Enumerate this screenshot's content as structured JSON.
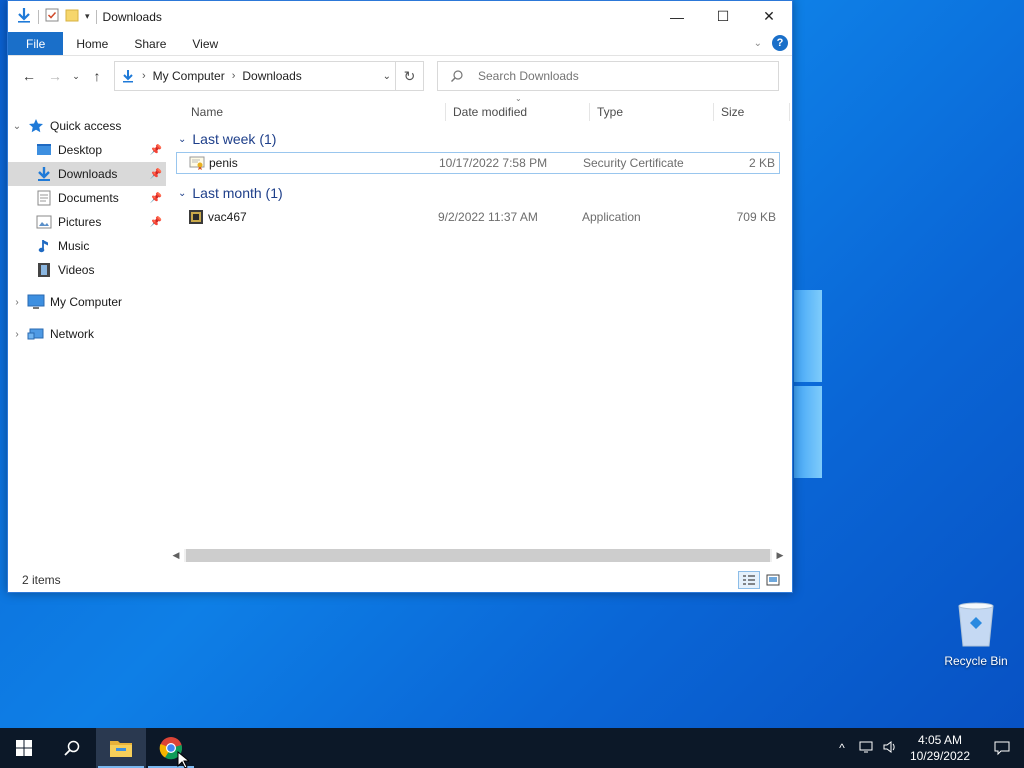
{
  "window": {
    "title": "Downloads",
    "controls": {
      "minimize": "—",
      "maximize": "☐",
      "close": "✕"
    }
  },
  "ribbon": {
    "tabs": [
      "File",
      "Home",
      "Share",
      "View"
    ],
    "help": "?"
  },
  "address": {
    "crumbs": [
      "My Computer",
      "Downloads"
    ],
    "search_placeholder": "Search Downloads"
  },
  "nav": {
    "quick_access": "Quick access",
    "items": [
      {
        "label": "Desktop",
        "pinned": true
      },
      {
        "label": "Downloads",
        "pinned": true,
        "selected": true
      },
      {
        "label": "Documents",
        "pinned": true
      },
      {
        "label": "Pictures",
        "pinned": true
      },
      {
        "label": "Music",
        "pinned": false
      },
      {
        "label": "Videos",
        "pinned": false
      }
    ],
    "my_computer": "My Computer",
    "network": "Network"
  },
  "columns": {
    "name": "Name",
    "date": "Date modified",
    "type": "Type",
    "size": "Size"
  },
  "groups": [
    {
      "label": "Last week (1)",
      "files": [
        {
          "name": "penis",
          "date": "10/17/2022 7:58 PM",
          "type": "Security Certificate",
          "size": "2 KB",
          "icon": "certificate-icon"
        }
      ]
    },
    {
      "label": "Last month (1)",
      "files": [
        {
          "name": "vac467",
          "date": "9/2/2022 11:37 AM",
          "type": "Application",
          "size": "709 KB",
          "icon": "application-icon"
        }
      ]
    }
  ],
  "status": {
    "item_count": "2 items"
  },
  "desktop": {
    "recycle_bin": "Recycle Bin"
  },
  "taskbar": {
    "time": "4:05 AM",
    "date": "10/29/2022"
  },
  "colors": {
    "accent": "#1a6fc9",
    "group_header": "#1e3f8a",
    "taskbar": "#0c1828"
  }
}
